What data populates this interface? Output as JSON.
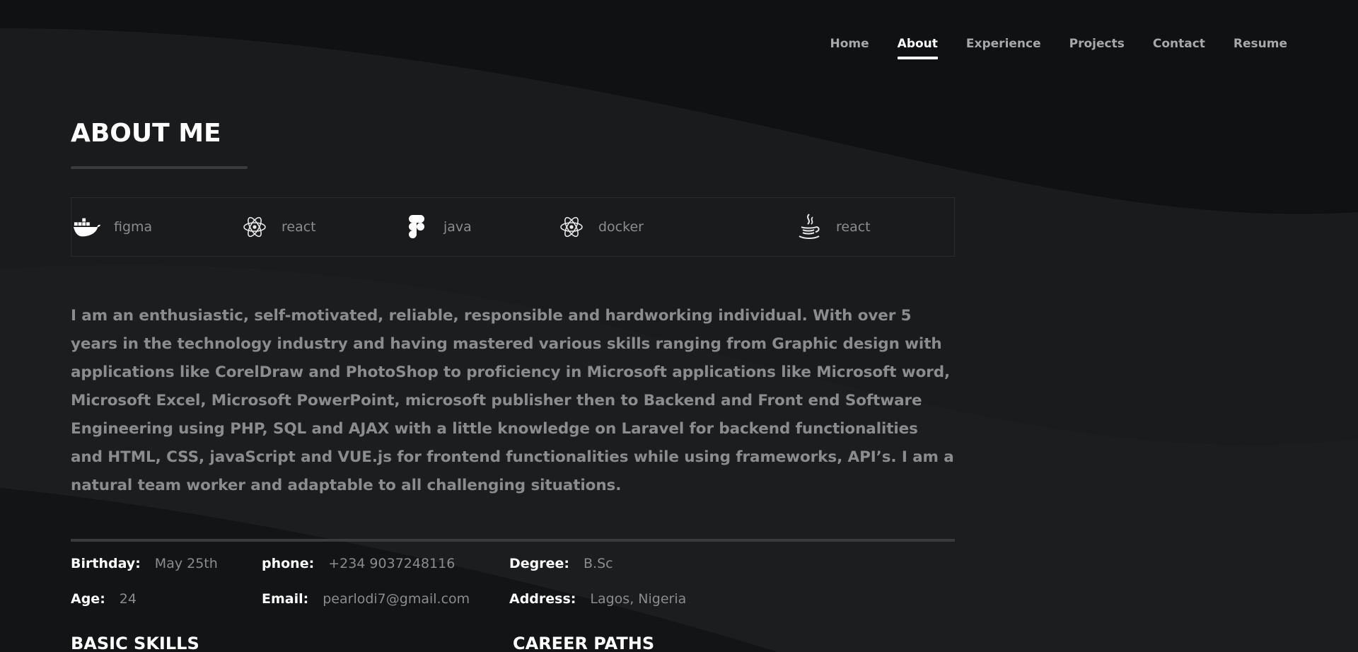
{
  "nav": {
    "items": [
      {
        "label": "Home",
        "active": false
      },
      {
        "label": "About",
        "active": true
      },
      {
        "label": "Experience",
        "active": false
      },
      {
        "label": "Projects",
        "active": false
      },
      {
        "label": "Contact",
        "active": false
      },
      {
        "label": "Resume",
        "active": false
      }
    ]
  },
  "about": {
    "title": "ABOUT ME",
    "skills": [
      {
        "label": "figma",
        "icon": "docker-icon"
      },
      {
        "label": "react",
        "icon": "react-icon"
      },
      {
        "label": "java",
        "icon": "figma-icon"
      },
      {
        "label": "docker",
        "icon": "react-icon"
      },
      {
        "label": "react",
        "icon": "java-icon"
      }
    ],
    "bio": "I am an enthusiastic, self-motivated, reliable, responsible and hardworking individual. With over 5 years in the technology industry and having mastered various skills ranging from Graphic design with applications like CorelDraw and PhotoShop to proficiency in Microsoft applications like Microsoft word, Microsoft Excel, Microsoft PowerPoint, microsoft publisher then to Backend and Front end Software Engineering using PHP, SQL and AJAX with a little knowledge on Laravel for backend functionalities and HTML, CSS, javaScript and VUE.js for frontend functionalities while using frameworks, API’s. I am a natural team worker and adaptable to all challenging situations.",
    "info": {
      "birthday": {
        "label": "Birthday:",
        "value": "May 25th"
      },
      "phone": {
        "label": "phone:",
        "value": "+234 9037248116"
      },
      "degree": {
        "label": "Degree:",
        "value": "B.Sc"
      },
      "age": {
        "label": "Age:",
        "value": "24"
      },
      "email": {
        "label": "Email:",
        "value": "pearlodi7@gmail.com"
      },
      "address": {
        "label": "Address:",
        "value": "Lagos, Nigeria"
      }
    }
  },
  "sections": {
    "basic_skills": "BASIC SKILLS",
    "career_paths": "CAREER PATHS"
  },
  "colors": {
    "background": "#151617",
    "text_primary": "#ffffff",
    "text_muted": "#8b8c8e",
    "nav_text": "#a7a8aa",
    "divider": "#3a3b3d"
  }
}
